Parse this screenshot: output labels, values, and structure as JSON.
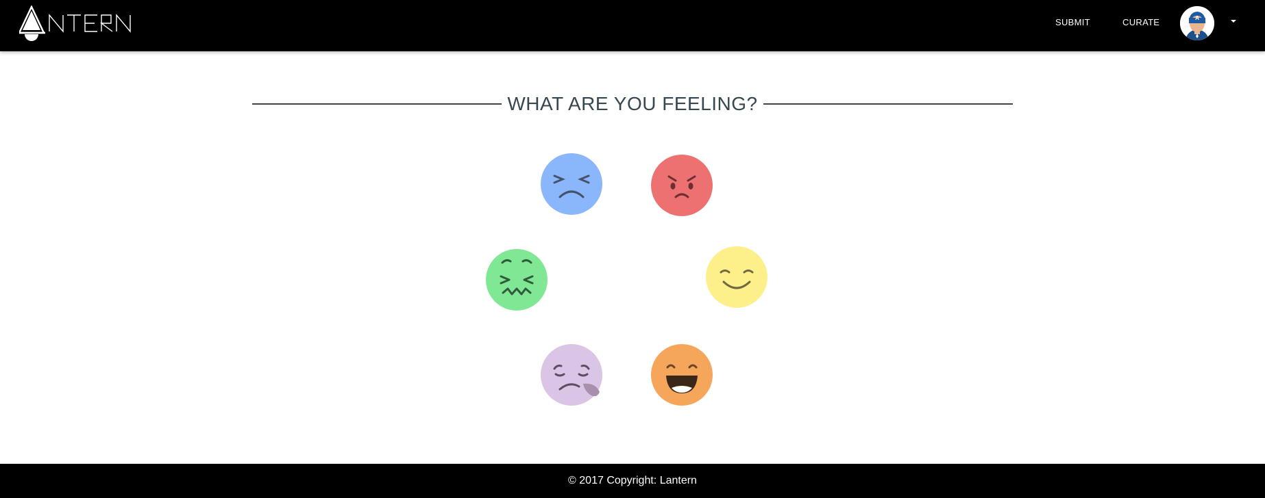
{
  "brand": {
    "name": "LANTERN",
    "logo_icon": "lantern-logo-icon"
  },
  "nav": {
    "submit_label": "SUBMIT",
    "curate_label": "CURATE",
    "avatar_icon": "captain-america-avatar",
    "dropdown_icon": "caret-down-icon"
  },
  "main": {
    "heading": "WHAT ARE YOU FEELING?",
    "emotions": [
      {
        "key": "sad",
        "icon": "sad-face-icon",
        "color": "#8ab6fb"
      },
      {
        "key": "angry",
        "icon": "angry-face-icon",
        "color": "#ee7172"
      },
      {
        "key": "sick",
        "icon": "nauseated-face-icon",
        "color": "#80e794"
      },
      {
        "key": "happy",
        "icon": "smiling-face-icon",
        "color": "#fdf08a"
      },
      {
        "key": "tired",
        "icon": "sleepy-face-icon",
        "color": "#dbc5e6"
      },
      {
        "key": "excited",
        "icon": "laughing-face-icon",
        "color": "#f5a65a"
      }
    ]
  },
  "footer": {
    "copyright": "© 2017 Copyright: Lantern"
  },
  "colors": {
    "navbar": "#000000",
    "footer": "#000000",
    "heading": "#37474f",
    "rule": "#424242"
  }
}
